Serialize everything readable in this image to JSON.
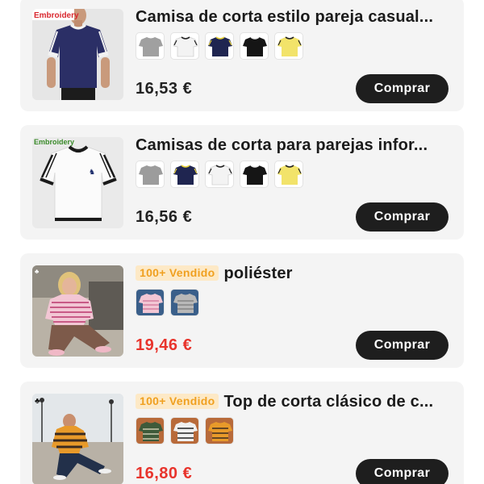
{
  "products": [
    {
      "title": "Camisa de corta estilo pareja casual...",
      "badge": "",
      "price": "16,53 €",
      "sale": false,
      "thumb_label": "Embroidery",
      "button": "Comprar",
      "swatches": [
        "gray-tshirt",
        "white-tshirt",
        "navy-tshirt",
        "black-tshirt",
        "yellow-tshirt"
      ]
    },
    {
      "title": "Camisas de corta para parejas infor...",
      "badge": "",
      "price": "16,56 €",
      "sale": false,
      "thumb_label": "Embroidery",
      "button": "Comprar",
      "swatches": [
        "gray-tshirt",
        "navy-tshirt",
        "white-tshirt",
        "black-tshirt",
        "yellow-tshirt"
      ]
    },
    {
      "title": "poliéster",
      "badge": "100+ Vendido",
      "price": "19,46 €",
      "sale": true,
      "button": "Comprar",
      "swatches": [
        "pink-striped-tshirt",
        "gray-striped-tshirt"
      ]
    },
    {
      "title": "Top de corta clásico de c...",
      "badge": "100+ Vendido",
      "price": "16,80 €",
      "sale": true,
      "button": "Comprar",
      "swatches": [
        "green-striped-tshirt",
        "white-striped-tshirt",
        "brown-striped-tshirt"
      ]
    }
  ],
  "colors": {
    "card_bg": "#f4f4f4",
    "button_bg": "#1e1e1e",
    "sale_price": "#e8342c",
    "badge_text": "#f0a020",
    "badge_bg": "#fde9c6"
  }
}
